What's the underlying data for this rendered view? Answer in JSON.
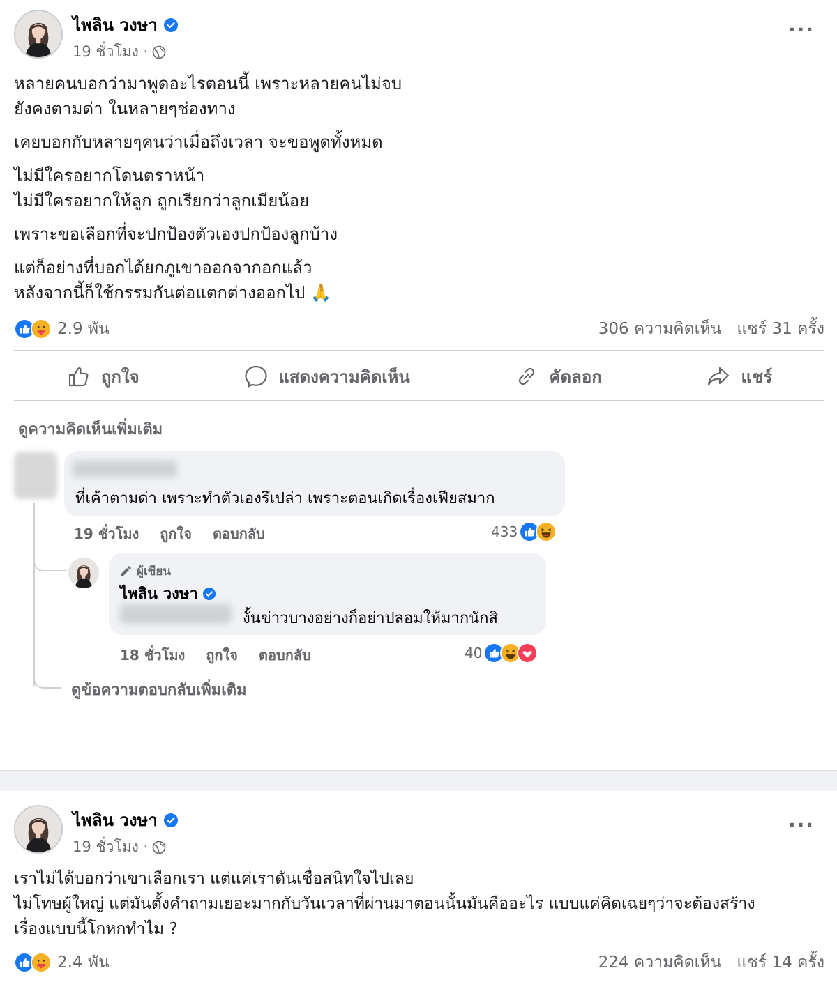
{
  "post1": {
    "author": "ไพลิน วงษา",
    "time": "19 ชั่วโมง ·",
    "more_label": "···",
    "paragraphs": [
      [
        "หลายคนบอกว่ามาพูดอะไรตอนนี้ เพราะหลายคนไม่จบ",
        "ยังคงตามด่า ในหลายๆช่องทาง"
      ],
      [
        "เคยบอกกับหลายๆคนว่าเมื่อถึงเวลา จะขอพูดทั้งหมด"
      ],
      [
        "ไม่มีใครอยากโดนตราหน้า",
        "ไม่มีใครอยากให้ลูก ถูกเรียกว่าลูกเมียน้อย"
      ],
      [
        "เพราะขอเลือกที่จะปกป้องตัวเองปกป้องลูกบ้าง"
      ],
      [
        "แต่ก็อย่างที่บอกได้ยกภูเขาออกจากอกแล้ว",
        "หลังจากนี้ก็ใช้กรรมกันต่อแตกต่างออกไป 🙏"
      ]
    ],
    "reaction_count": "2.9 พัน",
    "comments_count": "306 ความคิดเห็น",
    "shares_count": "แชร์ 31 ครั้ง",
    "actions": {
      "like": "ถูกใจ",
      "comment": "แสดงความคิดเห็น",
      "copy": "คัดลอก",
      "share": "แชร์"
    },
    "more_comments": "ดูความคิดเห็นเพิ่มเติม",
    "comment": {
      "text": "ที่เค้าตามด่า เพราะทำตัวเองรึเปล่า เพราะตอนเกิดเรื่องเฟียสมาก",
      "time": "19 ชั่วโมง",
      "like": "ถูกใจ",
      "reply": "ตอบกลับ",
      "reactions": "433"
    },
    "reply": {
      "author_tag": "ผู้เขียน",
      "author": "ไพลิน วงษา",
      "text": "งั้นข่าวบางอย่างก็อย่าปลอมให้มากนักสิ",
      "time": "18 ชั่วโมง",
      "like": "ถูกใจ",
      "reply": "ตอบกลับ",
      "reactions": "40"
    },
    "view_more_replies": "ดูข้อความตอบกลับเพิ่มเติม"
  },
  "post2": {
    "author": "ไพลิน วงษา",
    "time": "19 ชั่วโมง ·",
    "more_label": "···",
    "lines": [
      "เราไม่ได้บอกว่าเขาเลือกเรา แต่แค่เราดันเชื่อสนิทใจไปเลย",
      "ไม่โทษผู้ใหญ่ แต่มันตั้งคำถามเยอะมากกับวันเวลาที่ผ่านมาตอนนั้นมันคืออะไร แบบแค่คิดเฉยๆว่าจะต้องสร้าง",
      "เรื่องแบบนี้โกหกทำไม ?"
    ],
    "reaction_count": "2.4 พัน",
    "comments_count": "224 ความคิดเห็น",
    "shares_count": "แชร์ 14 ครั้ง"
  },
  "colors": {
    "facebook_blue": "#1877f2",
    "text_secondary": "#65676b",
    "bubble_bg": "#f0f2f5",
    "love_red": "#f33e58",
    "haha_yellow": "#f7b125"
  },
  "icons": [
    "verified-icon",
    "globe-icon",
    "more-icon",
    "like-reaction-icon",
    "care-reaction-icon",
    "haha-reaction-icon",
    "love-reaction-icon",
    "thumbs-up-icon",
    "comment-icon",
    "link-icon",
    "share-icon",
    "pencil-icon"
  ]
}
